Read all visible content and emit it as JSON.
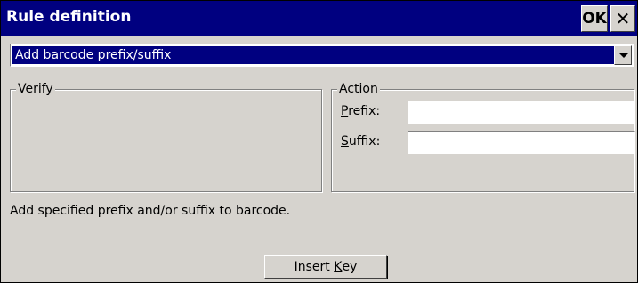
{
  "window": {
    "title": "Rule definition",
    "ok_label": "OK",
    "close_glyph": "✕"
  },
  "rule_select": {
    "value": "Add barcode prefix/suffix"
  },
  "verify_group": {
    "legend": "Verify"
  },
  "action_group": {
    "legend": "Action",
    "prefix_label_accel": "P",
    "prefix_label_rest": "refix:",
    "prefix_value": "",
    "suffix_label_accel": "S",
    "suffix_label_rest": "uffix:",
    "suffix_value": ""
  },
  "description": "Add specified prefix and/or suffix to barcode.",
  "insert_key": {
    "label_before": "Insert ",
    "label_accel": "K",
    "label_after": "ey"
  }
}
